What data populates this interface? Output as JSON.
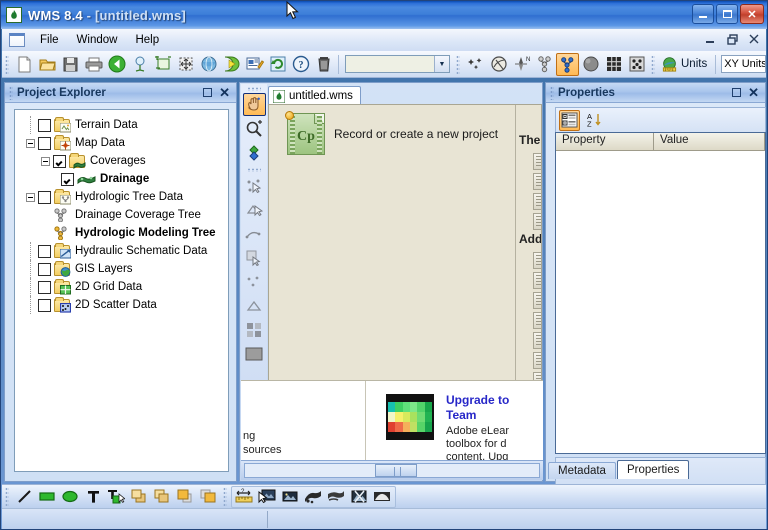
{
  "window": {
    "title_app": "WMS 8.4",
    "title_doc": " - [untitled.wms]",
    "app_icon": "wms-flame-icon",
    "buttons": {
      "minimize": "minimize-button",
      "maximize": "maximize-button",
      "close": "close-button"
    }
  },
  "menubar": {
    "icon": "document-window-icon",
    "items": [
      {
        "label": "File"
      },
      {
        "label": "Window"
      },
      {
        "label": "Help"
      }
    ],
    "mdi": {
      "minimize": "_",
      "restore": "❐",
      "close": "✕"
    }
  },
  "toolbar": {
    "icons": [
      {
        "name": "new-project-icon",
        "glyph": "page"
      },
      {
        "name": "open-folder-icon",
        "glyph": "folder"
      },
      {
        "name": "save-icon",
        "glyph": "floppy"
      },
      {
        "name": "print-icon",
        "glyph": "printer"
      },
      {
        "name": "back-icon",
        "glyph": "green-arrow"
      },
      {
        "name": "drainage-delineation-icon",
        "glyph": "tree-node"
      },
      {
        "name": "frame-image-icon",
        "glyph": "frame"
      },
      {
        "name": "pan-zoom-extents-icon",
        "glyph": "extents"
      },
      {
        "name": "globe-display-icon",
        "glyph": "globe"
      },
      {
        "name": "run-simulation-icon",
        "glyph": "play"
      },
      {
        "name": "display-options-icon",
        "glyph": "props"
      },
      {
        "name": "refresh-icon",
        "glyph": "refresh"
      },
      {
        "name": "help-icon",
        "glyph": "question"
      },
      {
        "name": "delete-icon",
        "glyph": "trash"
      }
    ],
    "combo_value": "",
    "module_icons": [
      {
        "name": "sparkle-icon",
        "glyph": "sparkle"
      },
      {
        "name": "coverage-module-icon",
        "glyph": "circle-slash"
      },
      {
        "name": "north-arrow-icon",
        "glyph": "north"
      },
      {
        "name": "drainage-tree-module-icon",
        "glyph": "nodes"
      },
      {
        "name": "hydrologic-modeling-module-icon",
        "glyph": "tree-selected",
        "selected": true
      },
      {
        "name": "terrain-module-icon",
        "glyph": "sphere"
      },
      {
        "name": "grid-module-icon",
        "glyph": "grid"
      },
      {
        "name": "scatter-module-icon",
        "glyph": "scatter"
      }
    ],
    "units_button": {
      "label": "Units",
      "icon": "units-globe-icon"
    },
    "xy_units_text": "XY Units: F"
  },
  "project_explorer": {
    "title": "Project Explorer",
    "maximize": "restore-button",
    "close": "close-button",
    "tree": [
      {
        "label": "Terrain Data",
        "icon": "terrain-data-folder-icon",
        "checked": false,
        "checkbox": true,
        "expander": "none",
        "indent": 1,
        "bold": false
      },
      {
        "label": "Map Data",
        "icon": "map-data-folder-icon",
        "checked": false,
        "checkbox": true,
        "expander": "minus",
        "indent": 1,
        "bold": false
      },
      {
        "label": "Coverages",
        "icon": "coverages-folder-icon",
        "checked": true,
        "checkbox": true,
        "expander": "minus",
        "indent": 2,
        "bold": false
      },
      {
        "label": "Drainage",
        "icon": "drainage-coverage-icon",
        "checked": true,
        "checkbox": true,
        "expander": "none",
        "indent": 3,
        "bold": true
      },
      {
        "label": "Hydrologic Tree Data",
        "icon": "hydrologic-tree-folder-icon",
        "checked": false,
        "checkbox": true,
        "expander": "minus",
        "indent": 1,
        "bold": false
      },
      {
        "label": "Drainage Coverage Tree",
        "icon": "drainage-coverage-tree-icon",
        "checked": false,
        "checkbox": false,
        "expander": "none",
        "indent": 2,
        "bold": false
      },
      {
        "label": "Hydrologic Modeling Tree",
        "icon": "hydrologic-modeling-tree-icon",
        "checked": false,
        "checkbox": false,
        "expander": "none",
        "indent": 2,
        "bold": true
      },
      {
        "label": "Hydraulic Schematic Data",
        "icon": "hydraulic-schematic-folder-icon",
        "checked": false,
        "checkbox": true,
        "expander": "none",
        "indent": 1,
        "bold": false
      },
      {
        "label": "GIS Layers",
        "icon": "gis-layers-folder-icon",
        "checked": false,
        "checkbox": true,
        "expander": "none",
        "indent": 1,
        "bold": false
      },
      {
        "label": "2D Grid Data",
        "icon": "grid-data-folder-icon",
        "checked": false,
        "checkbox": true,
        "expander": "none",
        "indent": 1,
        "bold": false
      },
      {
        "label": "2D Scatter Data",
        "icon": "scatter-data-folder-icon",
        "checked": false,
        "checkbox": true,
        "expander": "none",
        "indent": 1,
        "bold": false
      }
    ]
  },
  "vertical_toolbar": {
    "icons": [
      {
        "name": "pan-tool-icon",
        "selected": true
      },
      {
        "name": "zoom-tool-icon",
        "selected": false
      },
      {
        "name": "rotate-tool-icon",
        "selected": false
      },
      {
        "name": "select-point-tool-icon",
        "selected": false
      },
      {
        "name": "create-point-tool-icon",
        "selected": false
      },
      {
        "name": "select-arc-tool-icon",
        "selected": false
      },
      {
        "name": "create-arc-tool-icon",
        "selected": false
      },
      {
        "name": "select-polygon-tool-icon",
        "selected": false
      },
      {
        "name": "select-node-tool-icon",
        "selected": false
      },
      {
        "name": "create-polygon-tool-icon",
        "selected": false
      },
      {
        "name": "select-cells-tool-icon",
        "selected": false
      },
      {
        "name": "display-shade-tool-icon",
        "selected": false
      }
    ]
  },
  "document": {
    "tab_label": "untitled.wms",
    "tab_icon": "wms-flame-icon",
    "cp_icon": "captivate-project-icon",
    "cp_label": "Record or create a new project",
    "headings": [
      {
        "text": "The E"
      },
      {
        "text": "Addit"
      }
    ],
    "list_counts": {
      "group1": 4,
      "group2": 7
    },
    "promo": {
      "image": "color-swatch-thumbnail",
      "headline": "Upgrade to",
      "headline2": "Team",
      "body_lines": [
        " Adobe eLear",
        "toolbox for d",
        "content, Upg"
      ],
      "left_lines": [
        "ng",
        "sources"
      ]
    },
    "scrollbar": "horizontal-scrollbar"
  },
  "properties_panel": {
    "title": "Properties",
    "maximize": "restore-button",
    "close": "close-button",
    "toolbar_buttons": [
      {
        "name": "categorized-view-button",
        "selected": true
      },
      {
        "name": "alphabetical-sort-button",
        "selected": false
      }
    ],
    "columns": [
      "Property",
      "Value"
    ],
    "rows": [],
    "tabs": [
      {
        "label": "Metadata",
        "active": false
      },
      {
        "label": "Properties",
        "active": true
      }
    ]
  },
  "bottom_toolbar": {
    "group1": [
      {
        "name": "draw-line-icon"
      },
      {
        "name": "draw-rectangle-icon"
      },
      {
        "name": "draw-ellipse-icon"
      },
      {
        "name": "insert-text-icon"
      },
      {
        "name": "edit-text-icon"
      },
      {
        "name": "bring-to-front-icon"
      },
      {
        "name": "send-to-back-icon"
      },
      {
        "name": "bring-forward-icon"
      },
      {
        "name": "send-backward-icon"
      }
    ],
    "group2": [
      {
        "name": "measure-distance-icon"
      },
      {
        "name": "select-image-icon"
      },
      {
        "name": "image-properties-icon"
      },
      {
        "name": "clip-image-icon"
      },
      {
        "name": "crop-image-icon"
      },
      {
        "name": "cut-image-icon"
      },
      {
        "name": "terrain-shade-icon"
      }
    ]
  },
  "statusbar": {
    "left_text": "",
    "right_text": ""
  }
}
